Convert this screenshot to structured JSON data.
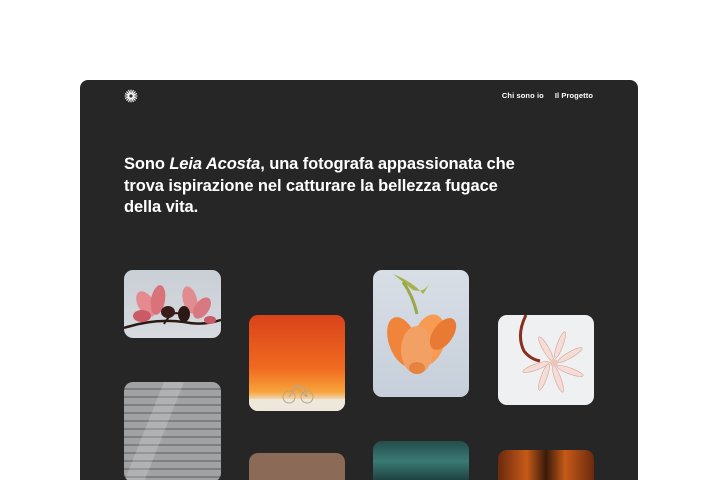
{
  "nav": {
    "about_label": "Chi sono io",
    "project_label": "Il Progetto"
  },
  "hero": {
    "intro": "Sono ",
    "name": "Leia Acosta",
    "rest": ", una fotografa appassionata che trova ispirazione nel catturare la bellezza fugace della vita."
  },
  "colors": {
    "background": "#262626",
    "text": "#ffffff"
  },
  "icons": {
    "logo": "sunburst-logo-icon"
  }
}
